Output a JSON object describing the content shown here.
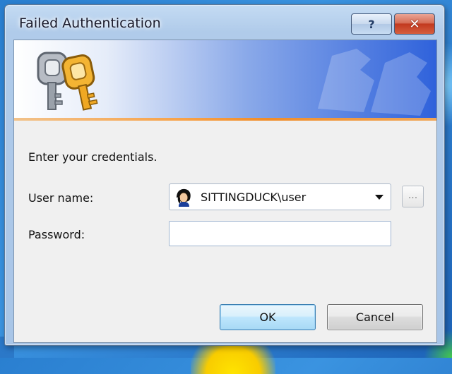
{
  "window": {
    "title": "Failed Authentication",
    "help_label": "?",
    "close_label": "✕"
  },
  "banner": {
    "icon": "keys-icon",
    "accent_colors": {
      "stripe": "#f7a249",
      "gradient_end": "#2f62db"
    }
  },
  "form": {
    "prompt": "Enter your credentials.",
    "username_label": "User name:",
    "username_value": "SITTINGDUCK\\user",
    "browse_label": "...",
    "password_label": "Password:",
    "password_value": ""
  },
  "buttons": {
    "ok_label": "OK",
    "cancel_label": "Cancel"
  }
}
